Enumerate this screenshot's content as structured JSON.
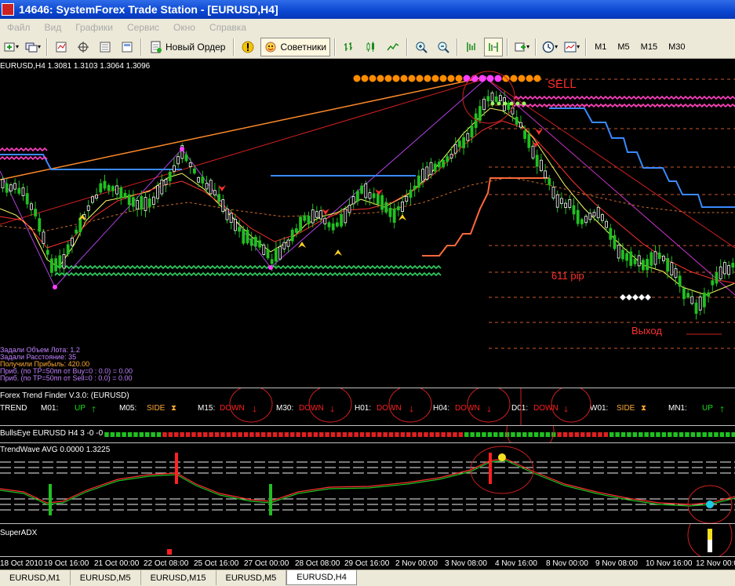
{
  "window": {
    "title": "14646: SystemForex Trade Station - [EURUSD,H4]"
  },
  "menu": [
    "Файл",
    "Вид",
    "Графики",
    "Сервис",
    "Окно",
    "Справка"
  ],
  "toolbar": {
    "new_order": "Новый Ордер",
    "experts": "Советники",
    "timeframes": [
      "M1",
      "M5",
      "M15",
      "M30"
    ]
  },
  "chart": {
    "symbol_info": "EURUSD,H4  1.3081 1.3103 1.3064 1.3096",
    "labels": {
      "sell": "SELL",
      "pips": "611 pip",
      "exit": "Выход"
    },
    "info_lines": [
      {
        "text": "Задали Объем Лота: 1.2",
        "color": "#c080ff"
      },
      {
        "text": "Задали Расстояние: 35",
        "color": "#c080ff"
      },
      {
        "text": "Получили Прибыль: 420.00",
        "color": "#ffaa33"
      },
      {
        "text": "Приб. (по TP=50пп от Buy=0 : 0.0) = 0.00",
        "color": "#c080ff"
      },
      {
        "text": "Приб. (по TP=50пп от Sell=0 : 0.0) = 0.00",
        "color": "#c080ff"
      }
    ]
  },
  "trend_finder": {
    "title": "Forex Trend Finder V.3.0: (EURUSD)",
    "items": [
      {
        "label": "TREND",
        "value": "",
        "arrow": ""
      },
      {
        "label": "M01:",
        "value": "UP",
        "arrow": "up"
      },
      {
        "label": "M05:",
        "value": "SIDE",
        "arrow": "side"
      },
      {
        "label": "M15:",
        "value": "DOWN",
        "arrow": "down"
      },
      {
        "label": "M30:",
        "value": "DOWN",
        "arrow": "down"
      },
      {
        "label": "H01:",
        "value": "DOWN",
        "arrow": "down"
      },
      {
        "label": "H04:",
        "value": "DOWN",
        "arrow": "down"
      },
      {
        "label": "D01:",
        "value": "DOWN",
        "arrow": "down"
      },
      {
        "label": "W01:",
        "value": "SIDE",
        "arrow": "side"
      },
      {
        "label": "MN1:",
        "value": "UP",
        "arrow": "up"
      }
    ]
  },
  "bullseye": {
    "title": "BullsEye EURUSD H4 3 -0 -0"
  },
  "trendwave": {
    "title": "TrendWave  AVG 0.0000 1.3225"
  },
  "superadx": {
    "title": "SuperADX"
  },
  "time_axis": [
    "18 Oct 2010",
    "19 Oct 16:00",
    "21 Oct 00:00",
    "22 Oct 08:00",
    "25 Oct 16:00",
    "27 Oct 00:00",
    "28 Oct 08:00",
    "29 Oct 16:00",
    "2 Nov 00:00",
    "3 Nov 08:00",
    "4 Nov 16:00",
    "8 Nov 00:00",
    "9 Nov 08:00",
    "10 Nov 16:00",
    "12 Nov 00:00"
  ],
  "tabs": [
    {
      "label": "EURUSD,M1",
      "active": false
    },
    {
      "label": "EURUSD,M5",
      "active": false
    },
    {
      "label": "EURUSD,M15",
      "active": false
    },
    {
      "label": "EURUSD,M5",
      "active": false
    },
    {
      "label": "EURUSD,H4",
      "active": true
    }
  ]
}
